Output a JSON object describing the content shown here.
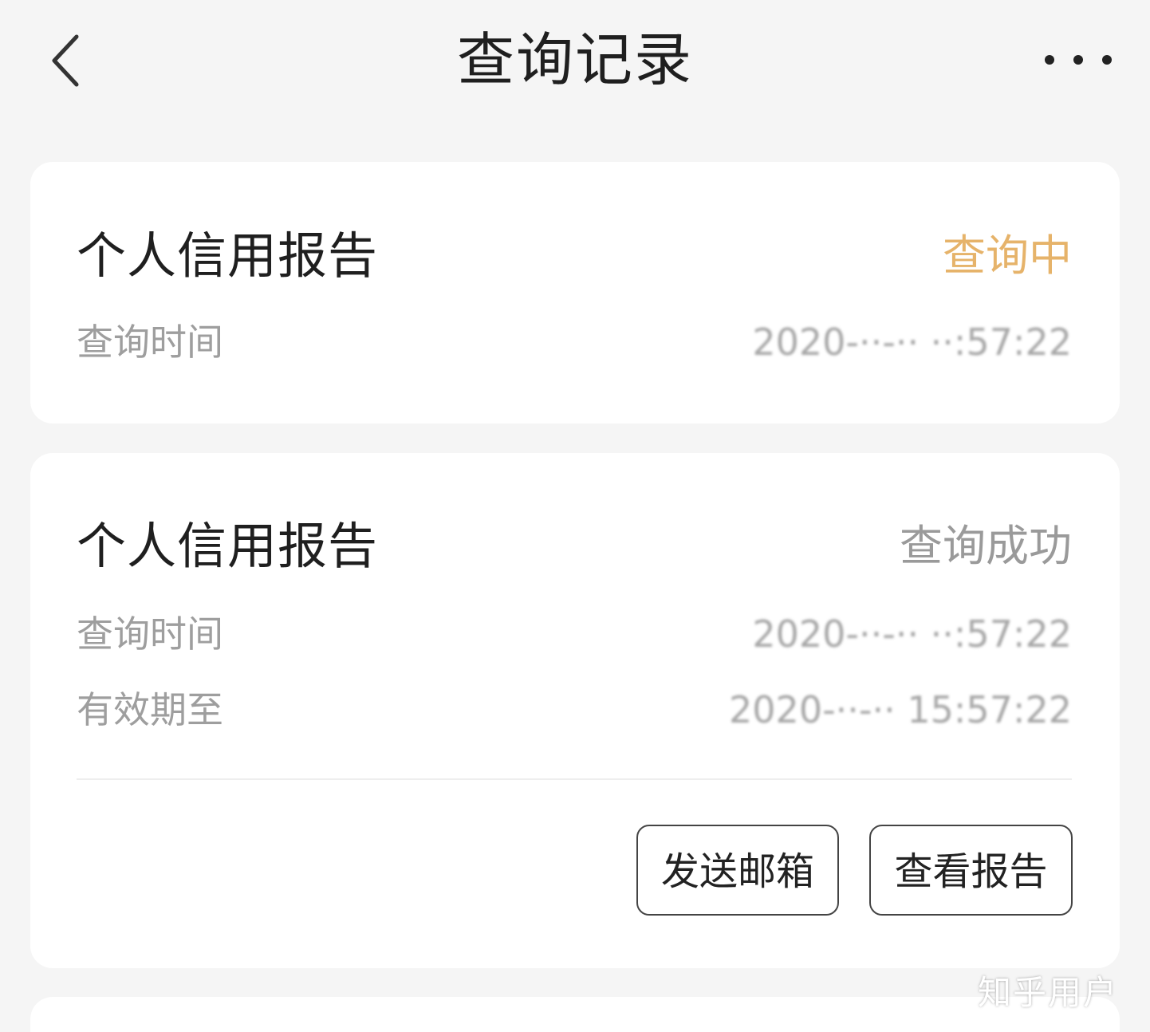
{
  "header": {
    "title": "查询记录",
    "back_icon": "chevron-left-icon",
    "more_icon": "more-horizontal-icon"
  },
  "records": [
    {
      "title": "个人信用报告",
      "status": "查询中",
      "status_color": "#e6b36a",
      "query_time_label": "查询时间",
      "query_time_value": "2020-··-·· ··:57:22"
    },
    {
      "title": "个人信用报告",
      "status": "查询成功",
      "status_color": "#9a9a9a",
      "query_time_label": "查询时间",
      "query_time_value": "2020-··-·· ··:57:22",
      "valid_until_label": "有效期至",
      "valid_until_value": "2020-··-·· 15:57:22",
      "actions": {
        "send_email": "发送邮箱",
        "view_report": "查看报告"
      }
    }
  ],
  "watermark": "知乎用户"
}
